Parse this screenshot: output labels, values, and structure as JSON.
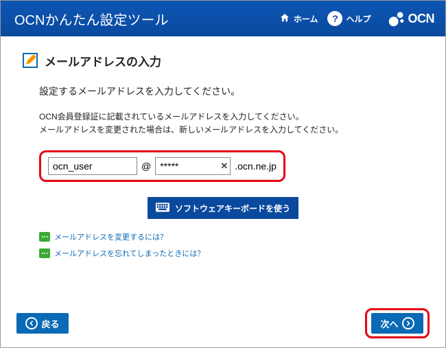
{
  "header": {
    "title": "OCNかんたん設定ツール",
    "home_label": "ホーム",
    "help_label": "ヘルプ",
    "logo_text": "OCN"
  },
  "section": {
    "title": "メールアドレスの入力",
    "lead": "設定するメールアドレスを入力してください。",
    "desc_line1": "OCN会員登録証に記載されているメールアドレスを入力してください。",
    "desc_line2": "メールアドレスを変更された場合は、新しいメールアドレスを入力してください。"
  },
  "email": {
    "user_value": "ocn_user",
    "at": "@",
    "domain_value": "*****",
    "suffix": ".ocn.ne.jp"
  },
  "keyboard_button": "ソフトウェアキーボードを使う",
  "help_links": [
    "メールアドレスを変更するには？",
    "メールアドレスを忘れてしまったときには？"
  ],
  "footer": {
    "back": "戻る",
    "next": "次へ"
  }
}
